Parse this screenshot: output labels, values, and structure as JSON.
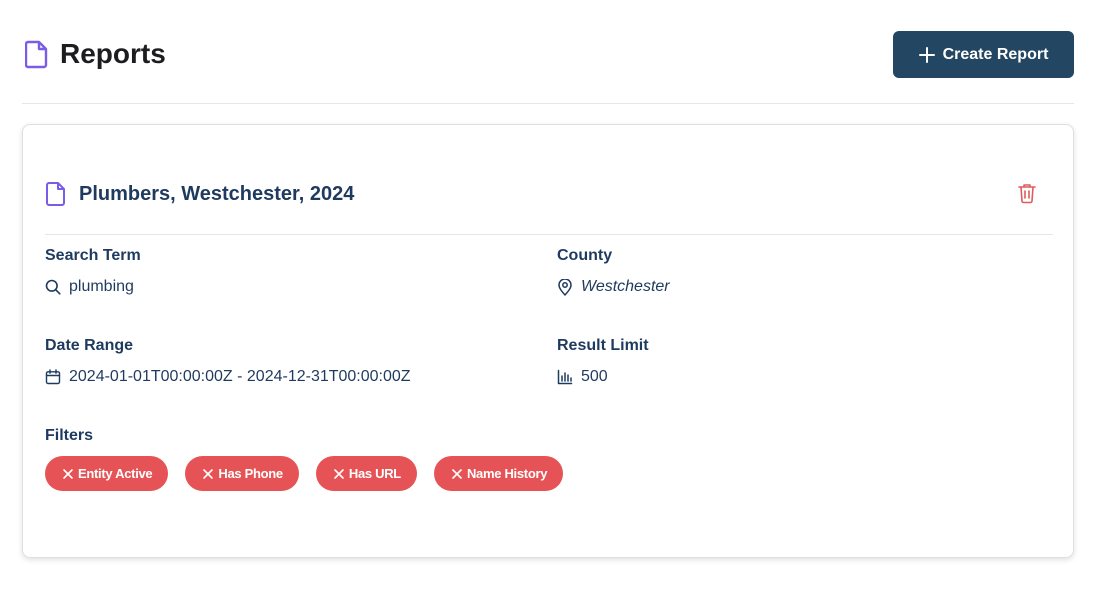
{
  "header": {
    "title": "Reports",
    "create_button_label": "Create Report"
  },
  "report": {
    "title": "Plumbers, Westchester, 2024",
    "fields": {
      "search_term": {
        "label": "Search Term",
        "value": "plumbing"
      },
      "county": {
        "label": "County",
        "value": "Westchester"
      },
      "date_range": {
        "label": "Date Range",
        "value": "2024-01-01T00:00:00Z - 2024-12-31T00:00:00Z"
      },
      "result_limit": {
        "label": "Result Limit",
        "value": "500"
      }
    },
    "filters_label": "Filters",
    "filters": [
      "Entity Active",
      "Has Phone",
      "Has URL",
      "Name History"
    ]
  },
  "colors": {
    "accent_icon": "#7b5ce6",
    "primary_button": "#234663",
    "text_primary": "#1f3a5f",
    "chip": "#e65356",
    "delete_icon": "#e05a5e"
  },
  "icons": {
    "page": "document-icon",
    "create": "plus-icon",
    "delete": "trash-icon",
    "search": "search-icon",
    "county": "map-pin-icon",
    "date": "calendar-icon",
    "limit": "bar-chart-icon",
    "chip_remove": "close-icon"
  }
}
